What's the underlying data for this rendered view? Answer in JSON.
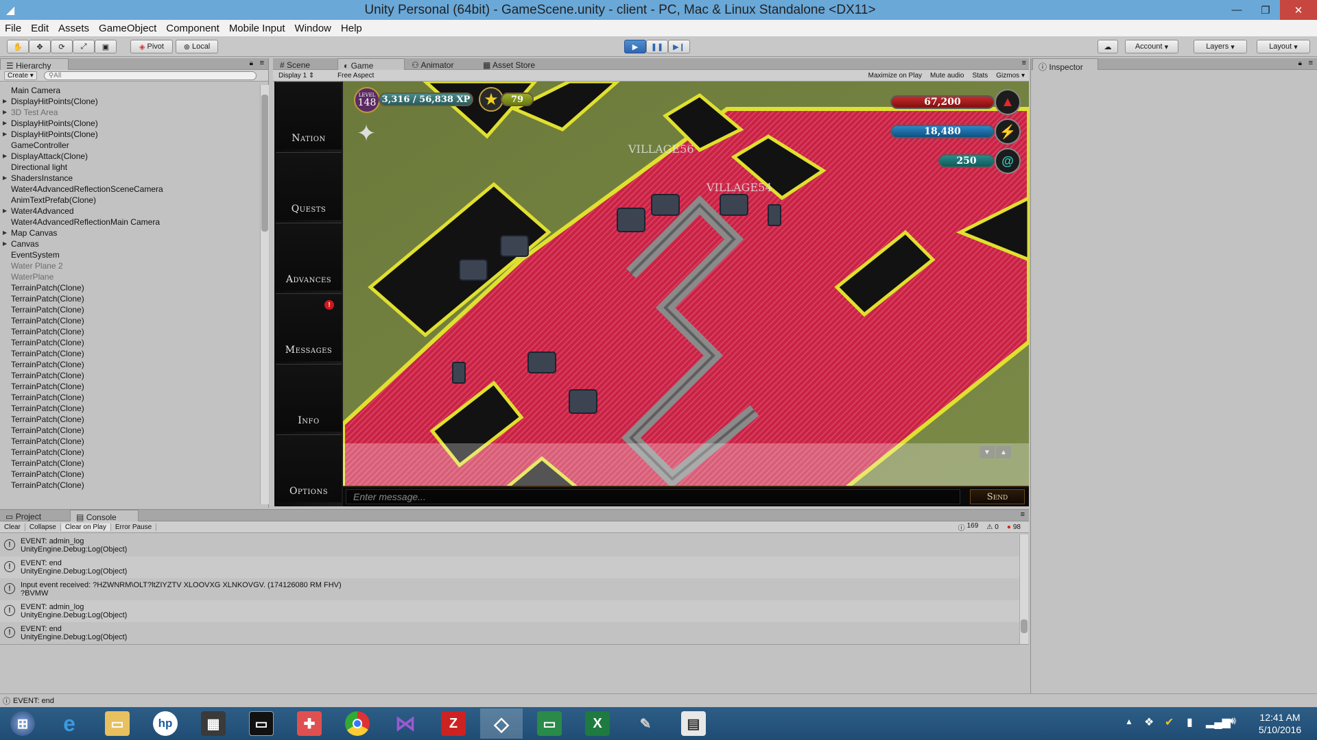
{
  "window": {
    "title": "Unity Personal (64bit) - GameScene.unity - client - PC, Mac & Linux Standalone <DX11>"
  },
  "menu": [
    "File",
    "Edit",
    "Assets",
    "GameObject",
    "Component",
    "Mobile Input",
    "Window",
    "Help"
  ],
  "toolbar": {
    "pivot": "Pivot",
    "local": "Local",
    "account": "Account",
    "layers": "Layers",
    "layout": "Layout"
  },
  "hierarchy": {
    "tab": "Hierarchy",
    "create": "Create",
    "search_placeholder": "All",
    "items": [
      {
        "label": "Main Camera",
        "expand": false,
        "dim": false
      },
      {
        "label": "DisplayHitPoints(Clone)",
        "expand": true,
        "dim": false
      },
      {
        "label": "3D Test Area",
        "expand": true,
        "dim": true
      },
      {
        "label": "DisplayHitPoints(Clone)",
        "expand": true,
        "dim": false
      },
      {
        "label": "DisplayHitPoints(Clone)",
        "expand": true,
        "dim": false
      },
      {
        "label": "GameController",
        "expand": false,
        "dim": false
      },
      {
        "label": "DisplayAttack(Clone)",
        "expand": true,
        "dim": false
      },
      {
        "label": "Directional light",
        "expand": false,
        "dim": false
      },
      {
        "label": "ShadersInstance",
        "expand": true,
        "dim": false
      },
      {
        "label": "Water4AdvancedReflectionSceneCamera",
        "expand": false,
        "dim": false
      },
      {
        "label": "AnimTextPrefab(Clone)",
        "expand": false,
        "dim": false
      },
      {
        "label": "Water4Advanced",
        "expand": true,
        "dim": false
      },
      {
        "label": "Water4AdvancedReflectionMain Camera",
        "expand": false,
        "dim": false
      },
      {
        "label": "Map Canvas",
        "expand": true,
        "dim": false
      },
      {
        "label": "Canvas",
        "expand": true,
        "dim": false
      },
      {
        "label": "EventSystem",
        "expand": false,
        "dim": false
      },
      {
        "label": "Water Plane 2",
        "expand": false,
        "dim": true
      },
      {
        "label": "WaterPlane",
        "expand": false,
        "dim": true
      },
      {
        "label": "TerrainPatch(Clone)",
        "expand": false,
        "dim": false
      },
      {
        "label": "TerrainPatch(Clone)",
        "expand": false,
        "dim": false
      },
      {
        "label": "TerrainPatch(Clone)",
        "expand": false,
        "dim": false
      },
      {
        "label": "TerrainPatch(Clone)",
        "expand": false,
        "dim": false
      },
      {
        "label": "TerrainPatch(Clone)",
        "expand": false,
        "dim": false
      },
      {
        "label": "TerrainPatch(Clone)",
        "expand": false,
        "dim": false
      },
      {
        "label": "TerrainPatch(Clone)",
        "expand": false,
        "dim": false
      },
      {
        "label": "TerrainPatch(Clone)",
        "expand": false,
        "dim": false
      },
      {
        "label": "TerrainPatch(Clone)",
        "expand": false,
        "dim": false
      },
      {
        "label": "TerrainPatch(Clone)",
        "expand": false,
        "dim": false
      },
      {
        "label": "TerrainPatch(Clone)",
        "expand": false,
        "dim": false
      },
      {
        "label": "TerrainPatch(Clone)",
        "expand": false,
        "dim": false
      },
      {
        "label": "TerrainPatch(Clone)",
        "expand": false,
        "dim": false
      },
      {
        "label": "TerrainPatch(Clone)",
        "expand": false,
        "dim": false
      },
      {
        "label": "TerrainPatch(Clone)",
        "expand": false,
        "dim": false
      },
      {
        "label": "TerrainPatch(Clone)",
        "expand": false,
        "dim": false
      },
      {
        "label": "TerrainPatch(Clone)",
        "expand": false,
        "dim": false
      },
      {
        "label": "TerrainPatch(Clone)",
        "expand": false,
        "dim": false
      },
      {
        "label": "TerrainPatch(Clone)",
        "expand": false,
        "dim": false
      }
    ]
  },
  "viewtabs": {
    "scene": "Scene",
    "game": "Game",
    "animator": "Animator",
    "asset_store": "Asset Store"
  },
  "gamebar": {
    "display": "Display 1",
    "aspect": "Free Aspect",
    "maximize": "Maximize on Play",
    "mute": "Mute audio",
    "stats": "Stats",
    "gizmos": "Gizmos"
  },
  "game": {
    "level_label": "LEVEL",
    "level": "148",
    "xp": "3,316 / 56,838 XP",
    "stars": "79",
    "resource1": "67,200",
    "resource2": "18,480",
    "resource3": "250",
    "village1": "VILLAGE56",
    "village2": "VILLAGE54",
    "nav": [
      "Nation",
      "Quests",
      "Advances",
      "Messages",
      "Info",
      "Options"
    ],
    "chat_placeholder": "Enter message...",
    "send": "Send"
  },
  "inspector": {
    "tab": "Inspector"
  },
  "bottom": {
    "project": "Project",
    "console": "Console"
  },
  "console": {
    "buttons": [
      "Clear",
      "Collapse",
      "Clear on Play",
      "Error Pause"
    ],
    "counts": {
      "info": "169",
      "warn": "0",
      "error": "98"
    },
    "rows": [
      {
        "line1": "EVENT: admin_log",
        "line2": "UnityEngine.Debug:Log(Object)"
      },
      {
        "line1": "EVENT: end",
        "line2": "UnityEngine.Debug:Log(Object)"
      },
      {
        "line1": "Input event received: ?HZWNRM\\OLT?ltZIYZTV XLOOVXG XLNKOVGV. (174126080 RM FHV)",
        "line2": "?BVMW"
      },
      {
        "line1": "EVENT: admin_log",
        "line2": "UnityEngine.Debug:Log(Object)"
      },
      {
        "line1": "EVENT: end",
        "line2": "UnityEngine.Debug:Log(Object)"
      }
    ]
  },
  "status": {
    "text": "EVENT: end"
  },
  "clock": {
    "time": "12:41 AM",
    "date": "5/10/2016"
  }
}
